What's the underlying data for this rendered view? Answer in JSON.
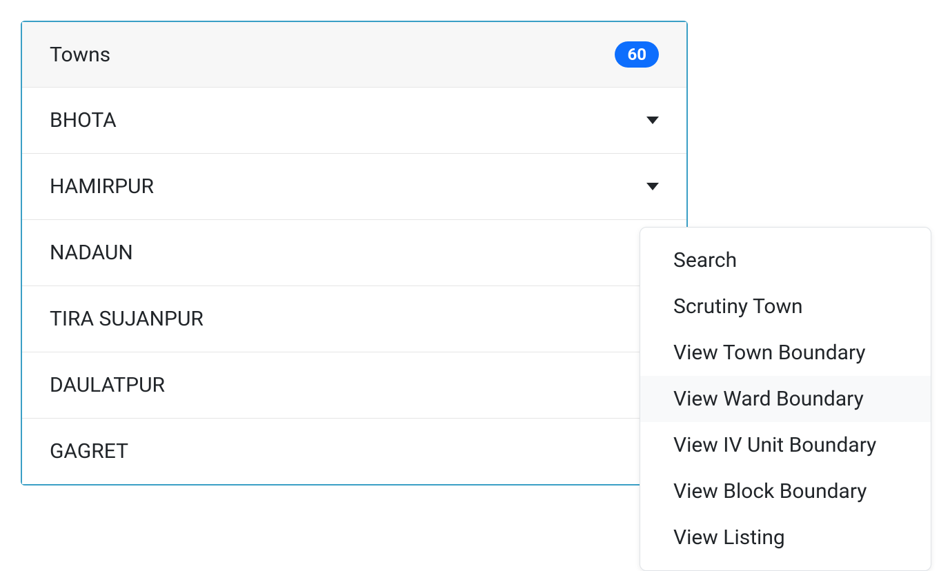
{
  "panel": {
    "title": "Towns",
    "badge": "60",
    "items": [
      {
        "name": "BHOTA",
        "has_caret": true
      },
      {
        "name": "HAMIRPUR",
        "has_caret": true
      },
      {
        "name": "NADAUN",
        "has_caret": false
      },
      {
        "name": "TIRA SUJANPUR",
        "has_caret": false
      },
      {
        "name": "DAULATPUR",
        "has_caret": false
      },
      {
        "name": "GAGRET",
        "has_caret": false
      }
    ]
  },
  "dropdown": {
    "items": [
      {
        "label": "Search",
        "highlighted": false
      },
      {
        "label": "Scrutiny Town",
        "highlighted": false
      },
      {
        "label": "View Town Boundary",
        "highlighted": false
      },
      {
        "label": "View Ward Boundary",
        "highlighted": true
      },
      {
        "label": "View IV Unit Boundary",
        "highlighted": false
      },
      {
        "label": "View Block Boundary",
        "highlighted": false
      },
      {
        "label": "View Listing",
        "highlighted": false
      }
    ]
  }
}
